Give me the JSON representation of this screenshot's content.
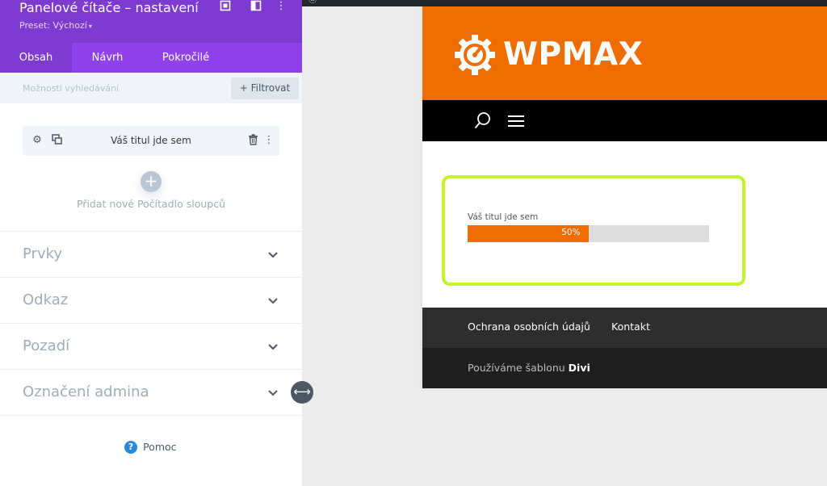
{
  "panel": {
    "title": "Panelové čítače – nastavení",
    "preset": "Preset: Výchozí",
    "tabs": [
      {
        "label": "Obsah",
        "active": true
      },
      {
        "label": "Návrh",
        "active": false
      },
      {
        "label": "Pokročilé",
        "active": false
      }
    ],
    "search_placeholder": "Možnosti vyhledávání",
    "filter_label": "Filtrovat",
    "item_title": "Váš titul jde sem",
    "add_label": "Přidat nové Počítadlo sloupců",
    "toggles": [
      {
        "label": "Prvky"
      },
      {
        "label": "Odkaz"
      },
      {
        "label": "Pozadí"
      },
      {
        "label": "Označení admina"
      }
    ],
    "help_label": "Pomoc",
    "accent_color": "#7e3bd0",
    "tab_bar_color": "#8f42ec"
  },
  "preview": {
    "logo_text": "WPMAX",
    "header_color": "#ef6c00",
    "counter": {
      "title": "Váš titul jde sem",
      "percent_label": "50%",
      "percent": 50,
      "bar_color": "#ef6c00",
      "outline_color": "#c2f62b"
    },
    "footer_links": [
      "Ochrana osobních údajů",
      "Kontakt"
    ],
    "credit_prefix": "Používáme šablonu",
    "credit_theme": "Divi"
  }
}
